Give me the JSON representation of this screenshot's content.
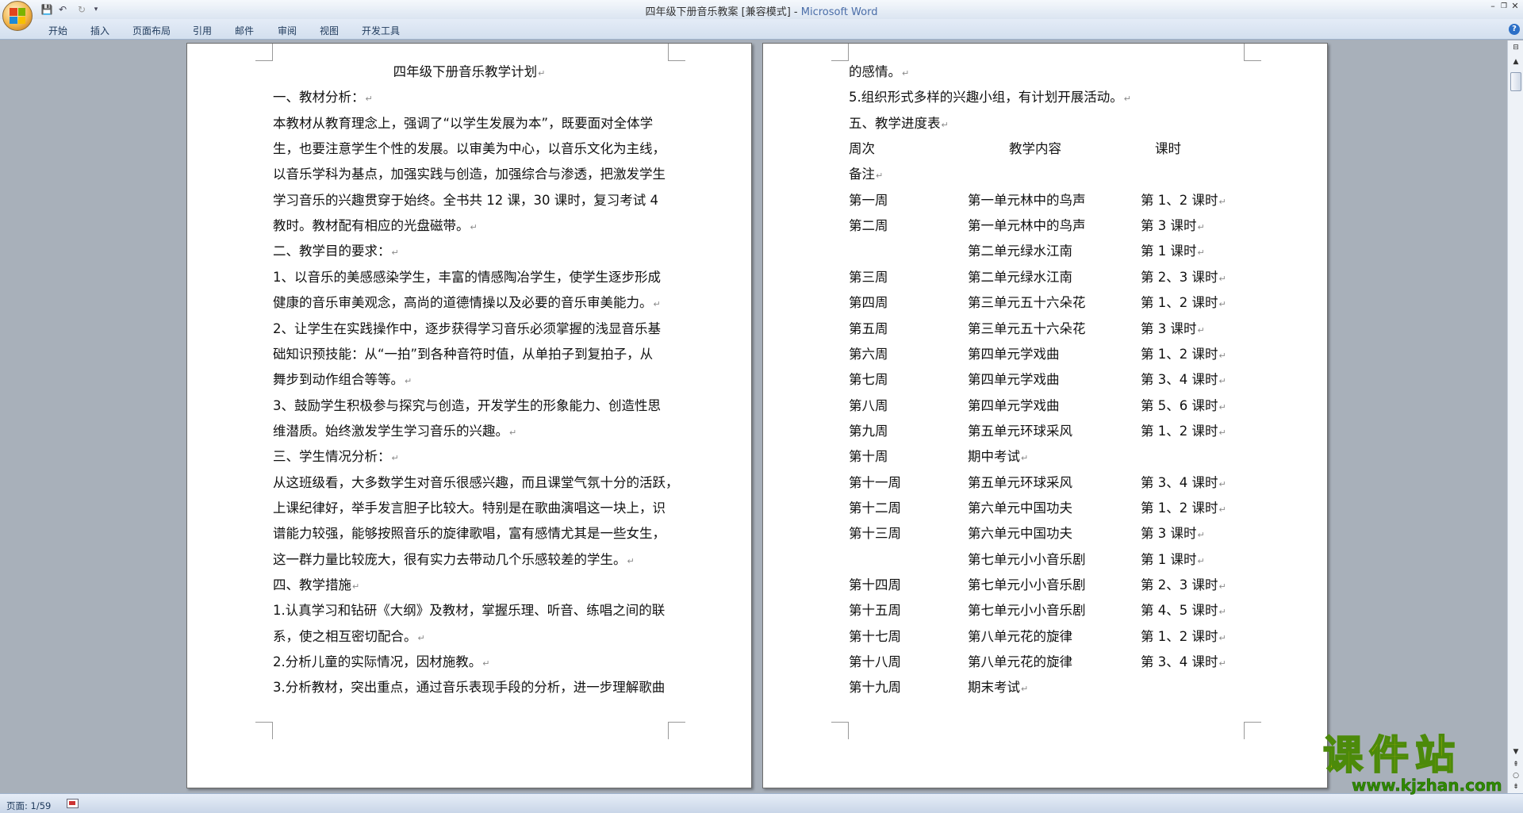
{
  "window": {
    "title_doc": "四年级下册音乐教案 [兼容模式]",
    "title_sep": " - ",
    "title_app": "Microsoft Word",
    "minimize": "–",
    "maximize": "❐",
    "close": "✕"
  },
  "qat": {
    "save": "💾",
    "undo": "↶",
    "redo": "↻",
    "more": "▾"
  },
  "ribbon": {
    "tabs": [
      "开始",
      "插入",
      "页面布局",
      "引用",
      "邮件",
      "审阅",
      "视图",
      "开发工具"
    ],
    "help": "?"
  },
  "page1": {
    "lines": [
      "四年级下册音乐教学计划",
      "一、教材分析：",
      "本教材从教育理念上，强调了“以学生发展为本”，既要面对全体学",
      "生，也要注意学生个性的发展。以审美为中心，以音乐文化为主线，",
      "以音乐学科为基点，加强实践与创造，加强综合与渗透，把激发学生",
      "学习音乐的兴趣贯穿于始终。全书共 12 课，30 课时，复习考试 4",
      "教时。教材配有相应的光盘磁带。",
      "二、教学目的要求：",
      "1、以音乐的美感感染学生，丰富的情感陶冶学生，使学生逐步形成",
      "健康的音乐审美观念，高尚的道德情操以及必要的音乐审美能力。",
      "2、让学生在实践操作中，逐步获得学习音乐必须掌握的浅显音乐基",
      "础知识预技能：从“一拍”到各种音符时值，从单拍子到复拍子，从",
      "舞步到动作组合等等。",
      "3、鼓励学生积极参与探究与创造，开发学生的形象能力、创造性思",
      "维潜质。始终激发学生学习音乐的兴趣。",
      "三、学生情况分析：",
      "从这班级看，大多数学生对音乐很感兴趣，而且课堂气氛十分的活跃，",
      "上课纪律好，举手发言胆子比较大。特别是在歌曲演唱这一块上，识",
      "谱能力较强，能够按照音乐的旋律歌唱，富有感情尤其是一些女生，",
      "这一群力量比较庞大，很有实力去带动几个乐感较差的学生。",
      "四、教学措施",
      "1.认真学习和钻研《大纲》及教材，掌握乐理、听音、练唱之间的联",
      "系，使之相互密切配合。",
      "2.分析儿童的实际情况，因材施教。",
      "3.分析教材，突出重点，通过音乐表现手段的分析，进一步理解歌曲"
    ],
    "para_marks": [
      true,
      true,
      false,
      false,
      false,
      false,
      true,
      true,
      false,
      true,
      false,
      false,
      true,
      false,
      true,
      true,
      false,
      false,
      false,
      true,
      true,
      false,
      true,
      true,
      false
    ]
  },
  "page2": {
    "intro_lines": [
      "的感情。",
      "5.组织形式多样的兴趣小组，有计划开展活动。",
      "五、教学进度表"
    ],
    "header": {
      "week": "周次",
      "content": "教学内容",
      "hours": "课时",
      "note": "备注"
    },
    "rows": [
      {
        "week": "第一周",
        "content": "第一单元林中的鸟声",
        "hours": "第 1、2 课时"
      },
      {
        "week": "第二周",
        "content": "第一单元林中的鸟声",
        "hours": "第 3 课时"
      },
      {
        "week": "",
        "content": "第二单元绿水江南",
        "hours": "第 1 课时"
      },
      {
        "week": "第三周",
        "content": "第二单元绿水江南",
        "hours": "第 2、3 课时"
      },
      {
        "week": "第四周",
        "content": "第三单元五十六朵花",
        "hours": "第 1、2 课时"
      },
      {
        "week": "第五周",
        "content": "第三单元五十六朵花",
        "hours": "第 3 课时"
      },
      {
        "week": "第六周",
        "content": "第四单元学戏曲",
        "hours": "第 1、2 课时"
      },
      {
        "week": "第七周",
        "content": "第四单元学戏曲",
        "hours": "第 3、4 课时"
      },
      {
        "week": "第八周",
        "content": "第四单元学戏曲",
        "hours": "第 5、6 课时"
      },
      {
        "week": "第九周",
        "content": "第五单元环球采风",
        "hours": "第 1、2 课时"
      },
      {
        "week": "第十周",
        "content": "期中考试",
        "hours": ""
      },
      {
        "week": "第十一周",
        "content": "第五单元环球采风",
        "hours": "第 3、4 课时"
      },
      {
        "week": "第十二周",
        "content": "第六单元中国功夫",
        "hours": "第 1、2 课时"
      },
      {
        "week": "第十三周",
        "content": "第六单元中国功夫",
        "hours": "第 3 课时"
      },
      {
        "week": "",
        "content": "第七单元小小音乐剧",
        "hours": "第 1 课时"
      },
      {
        "week": "第十四周",
        "content": "第七单元小小音乐剧",
        "hours": "第 2、3 课时"
      },
      {
        "week": "第十五周",
        "content": "第七单元小小音乐剧",
        "hours": "第 4、5 课时"
      },
      {
        "week": "第十七周",
        "content": "第八单元花的旋律",
        "hours": "第 1、2 课时"
      },
      {
        "week": "第十八周",
        "content": "第八单元花的旋律",
        "hours": "第 3、4 课时"
      },
      {
        "week": "第十九周",
        "content": "期末考试",
        "hours": ""
      }
    ]
  },
  "status": {
    "page": "页面: 1/59"
  },
  "watermark": {
    "main": "课件站",
    "url": "www.kjzhan.com"
  }
}
